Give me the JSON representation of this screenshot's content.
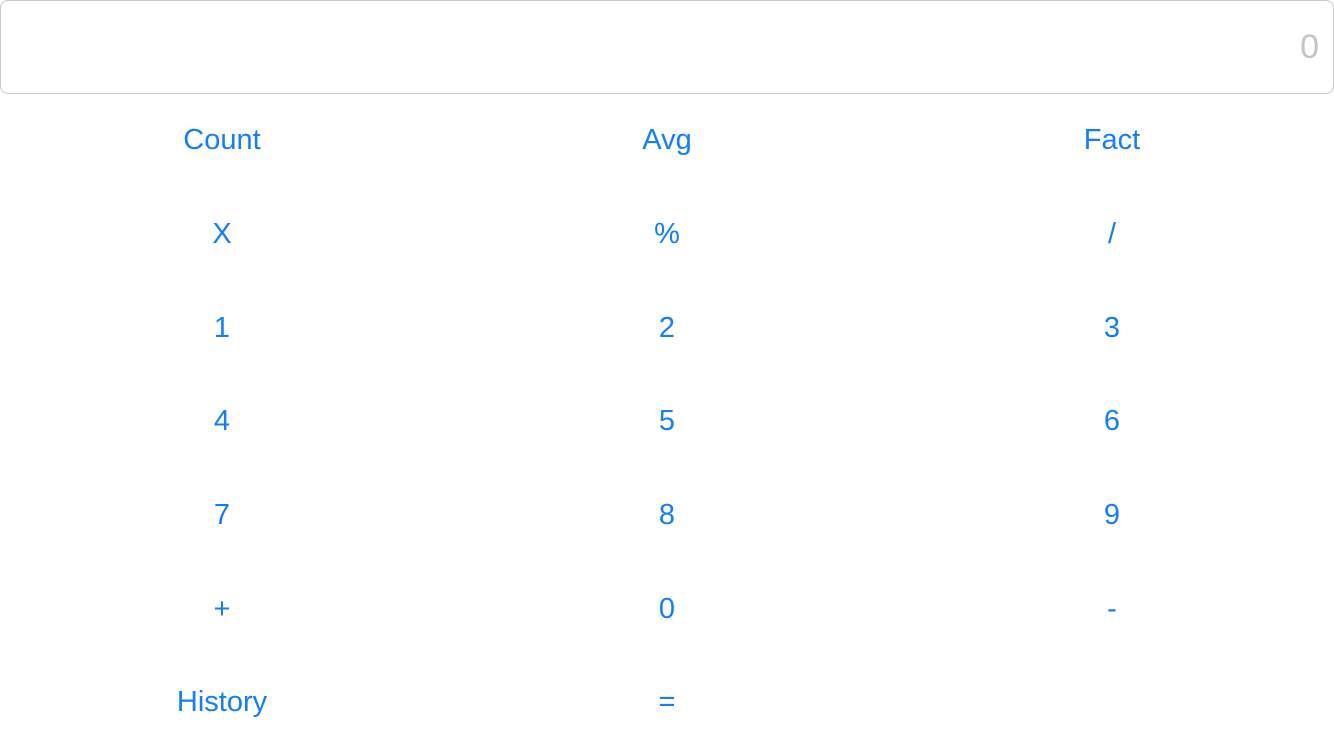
{
  "display": {
    "value": "",
    "placeholder": "0"
  },
  "keys": {
    "count": "Count",
    "avg": "Avg",
    "fact": "Fact",
    "multiply": "X",
    "percent": "%",
    "divide": "/",
    "one": "1",
    "two": "2",
    "three": "3",
    "four": "4",
    "five": "5",
    "six": "6",
    "seven": "7",
    "eight": "8",
    "nine": "9",
    "plus": "+",
    "zero": "0",
    "minus": "-",
    "history": "History",
    "equals": "="
  },
  "colors": {
    "accent": "#147efb",
    "placeholder": "#c4c4c6",
    "border": "#c8c8c8"
  }
}
